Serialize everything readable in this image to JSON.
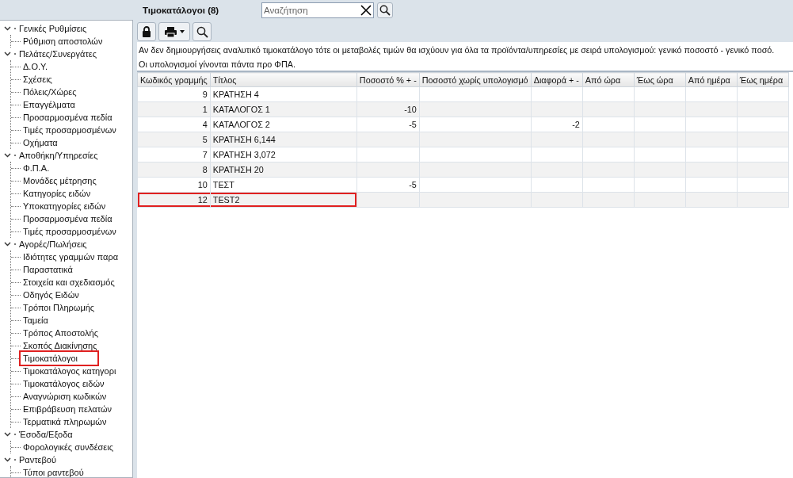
{
  "header": {
    "title": "Τιμοκατάλογοι (8)",
    "search": {
      "placeholder": "Αναζήτηση"
    }
  },
  "sidebar": {
    "items": [
      {
        "label": "Γενικές Ρυθμίσεις",
        "expanded": true,
        "children": [
          {
            "label": "Ρύθμιση αποστολών"
          }
        ]
      },
      {
        "label": "Πελάτες/Συνεργάτες",
        "expanded": true,
        "children": [
          {
            "label": "Δ.Ο.Υ."
          },
          {
            "label": "Σχέσεις"
          },
          {
            "label": "Πόλεις/Χώρες"
          },
          {
            "label": "Επαγγέλματα"
          },
          {
            "label": "Προσαρμοσμένα πεδία"
          },
          {
            "label": "Τιμές προσαρμοσμένων"
          },
          {
            "label": "Οχήματα"
          }
        ]
      },
      {
        "label": "Αποθήκη/Υπηρεσίες",
        "expanded": true,
        "children": [
          {
            "label": "Φ.Π.Α."
          },
          {
            "label": "Μονάδες μέτρησης"
          },
          {
            "label": "Κατηγορίες ειδών"
          },
          {
            "label": "Υποκατηγορίες ειδών"
          },
          {
            "label": "Προσαρμοσμένα πεδία"
          },
          {
            "label": "Τιμές προσαρμοσμένων"
          }
        ]
      },
      {
        "label": "Αγορές/Πωλήσεις",
        "expanded": true,
        "children": [
          {
            "label": "Ιδιότητες γραμμών παρα"
          },
          {
            "label": "Παραστατικά"
          },
          {
            "label": "Στοιχεία και σχεδιασμός"
          },
          {
            "label": "Οδηγός Ειδών"
          },
          {
            "label": "Τρόποι Πληρωμής"
          },
          {
            "label": "Ταμεία"
          },
          {
            "label": "Τρόπος Αποστολής"
          },
          {
            "label": "Σκοπός Διακίνησης"
          },
          {
            "label": "Τιμοκατάλογοι",
            "highlighted": true
          },
          {
            "label": "Τιμοκατάλογος κατηγορι"
          },
          {
            "label": "Τιμοκατάλογος ειδών"
          },
          {
            "label": "Αναγνώριση κωδικών"
          },
          {
            "label": "Επιβράβευση πελατών"
          },
          {
            "label": "Τερματικά πληρωμών"
          }
        ]
      },
      {
        "label": "Έσοδα/Εξοδα",
        "expanded": true,
        "children": [
          {
            "label": "Φορολογικές συνδέσεις"
          }
        ]
      },
      {
        "label": "Ραντεβού",
        "expanded": true,
        "children": [
          {
            "label": "Τύποι ραντεβού"
          }
        ]
      }
    ]
  },
  "info": [
    "Αν δεν δημιουργήσεις αναλυτικό τιμοκατάλογο τότε οι μεταβολές τιμών θα ισχύουν για όλα τα προϊόντα/υπηρεσίες με σειρά υπολογισμού: γενικό ποσοστό - γενικό ποσό.",
    "Οι υπολογισμοί γίνονται πάντα προ ΦΠΑ."
  ],
  "table": {
    "columns": [
      "Κωδικός γραμμής",
      "Τίτλος",
      "Ποσοστό % + -",
      "Ποσοστό χωρίς υπολογισμό",
      "Διαφορά + -",
      "Από ώρα",
      "Έως ώρα",
      "Από ημέρα",
      "Έως ημέρα"
    ],
    "rows": [
      {
        "code": "9",
        "title": "ΚΡΑΤΗΣΗ 4"
      },
      {
        "code": "1",
        "title": "ΚΑΤΑΛΟΓΟΣ 1",
        "percent": "-10"
      },
      {
        "code": "4",
        "title": "ΚΑΤΑΛΟΓΟΣ 2",
        "percent": "-5",
        "difference": "-2"
      },
      {
        "code": "5",
        "title": "ΚΡΑΤΗΣΗ 6,144"
      },
      {
        "code": "7",
        "title": "ΚΡΑΤΗΣΗ 3,072"
      },
      {
        "code": "8",
        "title": "ΚΡΑΤΗΣΗ 20"
      },
      {
        "code": "10",
        "title": "ΤΕΣΤ",
        "percent": "-5"
      },
      {
        "code": "12",
        "title": "TEST2",
        "highlighted": true
      }
    ]
  }
}
